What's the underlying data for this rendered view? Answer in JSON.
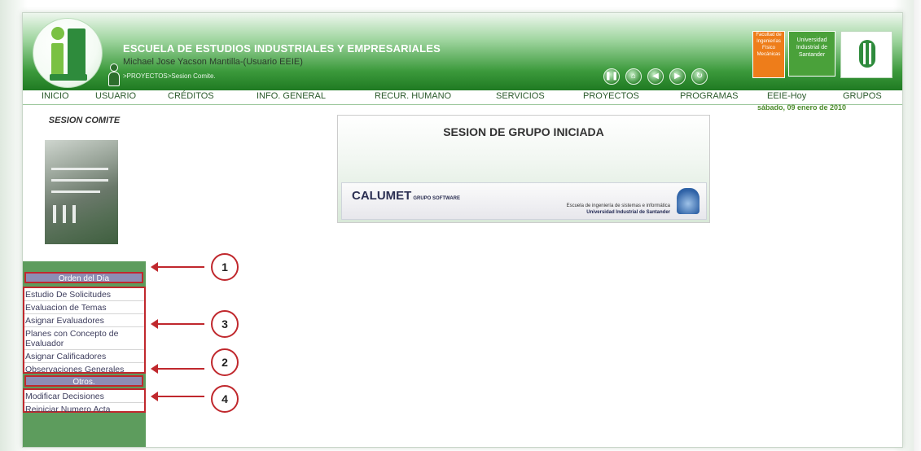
{
  "header": {
    "school_title": "ESCUELA DE ESTUDIOS INDUSTRIALES Y EMPRESARIALES",
    "user_line": "Michael Jose Yacson Mantilla-(Usuario EEIE)",
    "breadcrumb": ">PROYECTOS>Sesion Comite.",
    "faculty_lines": [
      "Facultad de",
      "Ingenierías",
      "Físico",
      "Mecánicas"
    ],
    "university_lines": [
      "Universidad",
      "Industrial de",
      "Santander"
    ]
  },
  "menu": [
    "INICIO",
    "USUARIO",
    "CRÉDITOS",
    "INFO. GENERAL",
    "RECUR. HUMANO",
    "SERVICIOS",
    "PROYECTOS",
    "PROGRAMAS",
    "EEIE-Hoy",
    "GRUPOS"
  ],
  "date": "sábado, 09 enero de 2010",
  "sidebar": {
    "title": "SESION COMITE",
    "section1": "Orden del Día",
    "group1": [
      "Estudio De Solicitudes",
      "Evaluacion de Temas",
      "Asignar Evaluadores",
      "Planes con Concepto de Evaluador",
      "Asignar Calificadores",
      "Observaciones Generales"
    ],
    "section2": "Otros.",
    "group2": [
      "Modificar Decisiones",
      "Reiniciar Numero Acta"
    ]
  },
  "panel": {
    "title": "SESION DE GRUPO INICIADA",
    "brand": "CALUMET",
    "brand_sub": "GRUPO SOFTWARE",
    "desc1": "Escuela de ingeniería de sistemas e informática",
    "desc2": "Universidad Industrial de Santander"
  },
  "callouts": [
    "1",
    "3",
    "2",
    "4"
  ],
  "colors": {
    "annotation": "#c0282d",
    "header_green": "#3c9a3c",
    "sidebar_green": "#5d9c5d"
  }
}
